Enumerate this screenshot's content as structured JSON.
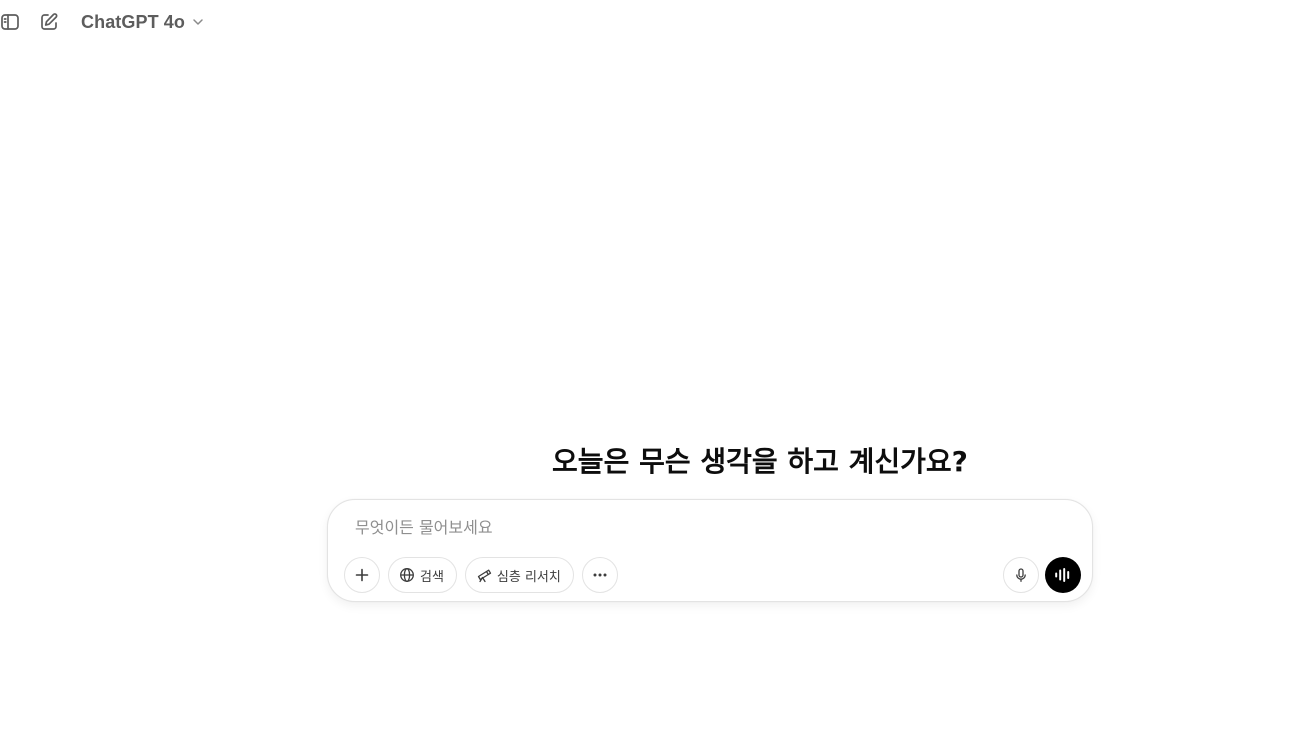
{
  "header": {
    "model_name": "ChatGPT 4o",
    "icons": {
      "sidebar_toggle": "sidebar-toggle-icon",
      "new_chat": "new-chat-icon",
      "model_dropdown": "chevron-down-icon"
    }
  },
  "main": {
    "greeting": "오늘은 무슨 생각을 하고 계신가요?"
  },
  "composer": {
    "placeholder": "무엇이든 물어보세요",
    "tools": {
      "add_icon": "plus-icon",
      "search_label": "검색",
      "search_icon": "globe-icon",
      "deep_research_label": "심층 리서치",
      "deep_research_icon": "telescope-icon",
      "more_icon": "ellipsis-icon"
    },
    "mic_icon": "microphone-icon",
    "voice_icon": "voice-waveform-icon"
  },
  "colors": {
    "background": "#ffffff",
    "text_primary": "#0d0d0d",
    "text_secondary": "#5d5d5d",
    "placeholder": "#8f8f8f",
    "border": "#e3e3e3",
    "voice_button": "#000000"
  }
}
